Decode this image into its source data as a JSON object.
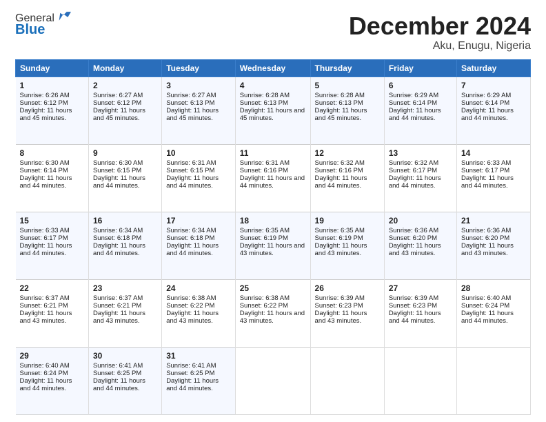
{
  "logo": {
    "general": "General",
    "blue": "Blue"
  },
  "header": {
    "month": "December 2024",
    "location": "Aku, Enugu, Nigeria"
  },
  "days_of_week": [
    "Sunday",
    "Monday",
    "Tuesday",
    "Wednesday",
    "Thursday",
    "Friday",
    "Saturday"
  ],
  "weeks": [
    [
      {
        "day": "1",
        "sunrise": "Sunrise: 6:26 AM",
        "sunset": "Sunset: 6:12 PM",
        "daylight": "Daylight: 11 hours and 45 minutes."
      },
      {
        "day": "2",
        "sunrise": "Sunrise: 6:27 AM",
        "sunset": "Sunset: 6:12 PM",
        "daylight": "Daylight: 11 hours and 45 minutes."
      },
      {
        "day": "3",
        "sunrise": "Sunrise: 6:27 AM",
        "sunset": "Sunset: 6:13 PM",
        "daylight": "Daylight: 11 hours and 45 minutes."
      },
      {
        "day": "4",
        "sunrise": "Sunrise: 6:28 AM",
        "sunset": "Sunset: 6:13 PM",
        "daylight": "Daylight: 11 hours and 45 minutes."
      },
      {
        "day": "5",
        "sunrise": "Sunrise: 6:28 AM",
        "sunset": "Sunset: 6:13 PM",
        "daylight": "Daylight: 11 hours and 45 minutes."
      },
      {
        "day": "6",
        "sunrise": "Sunrise: 6:29 AM",
        "sunset": "Sunset: 6:14 PM",
        "daylight": "Daylight: 11 hours and 44 minutes."
      },
      {
        "day": "7",
        "sunrise": "Sunrise: 6:29 AM",
        "sunset": "Sunset: 6:14 PM",
        "daylight": "Daylight: 11 hours and 44 minutes."
      }
    ],
    [
      {
        "day": "8",
        "sunrise": "Sunrise: 6:30 AM",
        "sunset": "Sunset: 6:14 PM",
        "daylight": "Daylight: 11 hours and 44 minutes."
      },
      {
        "day": "9",
        "sunrise": "Sunrise: 6:30 AM",
        "sunset": "Sunset: 6:15 PM",
        "daylight": "Daylight: 11 hours and 44 minutes."
      },
      {
        "day": "10",
        "sunrise": "Sunrise: 6:31 AM",
        "sunset": "Sunset: 6:15 PM",
        "daylight": "Daylight: 11 hours and 44 minutes."
      },
      {
        "day": "11",
        "sunrise": "Sunrise: 6:31 AM",
        "sunset": "Sunset: 6:16 PM",
        "daylight": "Daylight: 11 hours and 44 minutes."
      },
      {
        "day": "12",
        "sunrise": "Sunrise: 6:32 AM",
        "sunset": "Sunset: 6:16 PM",
        "daylight": "Daylight: 11 hours and 44 minutes."
      },
      {
        "day": "13",
        "sunrise": "Sunrise: 6:32 AM",
        "sunset": "Sunset: 6:17 PM",
        "daylight": "Daylight: 11 hours and 44 minutes."
      },
      {
        "day": "14",
        "sunrise": "Sunrise: 6:33 AM",
        "sunset": "Sunset: 6:17 PM",
        "daylight": "Daylight: 11 hours and 44 minutes."
      }
    ],
    [
      {
        "day": "15",
        "sunrise": "Sunrise: 6:33 AM",
        "sunset": "Sunset: 6:17 PM",
        "daylight": "Daylight: 11 hours and 44 minutes."
      },
      {
        "day": "16",
        "sunrise": "Sunrise: 6:34 AM",
        "sunset": "Sunset: 6:18 PM",
        "daylight": "Daylight: 11 hours and 44 minutes."
      },
      {
        "day": "17",
        "sunrise": "Sunrise: 6:34 AM",
        "sunset": "Sunset: 6:18 PM",
        "daylight": "Daylight: 11 hours and 44 minutes."
      },
      {
        "day": "18",
        "sunrise": "Sunrise: 6:35 AM",
        "sunset": "Sunset: 6:19 PM",
        "daylight": "Daylight: 11 hours and 43 minutes."
      },
      {
        "day": "19",
        "sunrise": "Sunrise: 6:35 AM",
        "sunset": "Sunset: 6:19 PM",
        "daylight": "Daylight: 11 hours and 43 minutes."
      },
      {
        "day": "20",
        "sunrise": "Sunrise: 6:36 AM",
        "sunset": "Sunset: 6:20 PM",
        "daylight": "Daylight: 11 hours and 43 minutes."
      },
      {
        "day": "21",
        "sunrise": "Sunrise: 6:36 AM",
        "sunset": "Sunset: 6:20 PM",
        "daylight": "Daylight: 11 hours and 43 minutes."
      }
    ],
    [
      {
        "day": "22",
        "sunrise": "Sunrise: 6:37 AM",
        "sunset": "Sunset: 6:21 PM",
        "daylight": "Daylight: 11 hours and 43 minutes."
      },
      {
        "day": "23",
        "sunrise": "Sunrise: 6:37 AM",
        "sunset": "Sunset: 6:21 PM",
        "daylight": "Daylight: 11 hours and 43 minutes."
      },
      {
        "day": "24",
        "sunrise": "Sunrise: 6:38 AM",
        "sunset": "Sunset: 6:22 PM",
        "daylight": "Daylight: 11 hours and 43 minutes."
      },
      {
        "day": "25",
        "sunrise": "Sunrise: 6:38 AM",
        "sunset": "Sunset: 6:22 PM",
        "daylight": "Daylight: 11 hours and 43 minutes."
      },
      {
        "day": "26",
        "sunrise": "Sunrise: 6:39 AM",
        "sunset": "Sunset: 6:23 PM",
        "daylight": "Daylight: 11 hours and 43 minutes."
      },
      {
        "day": "27",
        "sunrise": "Sunrise: 6:39 AM",
        "sunset": "Sunset: 6:23 PM",
        "daylight": "Daylight: 11 hours and 44 minutes."
      },
      {
        "day": "28",
        "sunrise": "Sunrise: 6:40 AM",
        "sunset": "Sunset: 6:24 PM",
        "daylight": "Daylight: 11 hours and 44 minutes."
      }
    ],
    [
      {
        "day": "29",
        "sunrise": "Sunrise: 6:40 AM",
        "sunset": "Sunset: 6:24 PM",
        "daylight": "Daylight: 11 hours and 44 minutes."
      },
      {
        "day": "30",
        "sunrise": "Sunrise: 6:41 AM",
        "sunset": "Sunset: 6:25 PM",
        "daylight": "Daylight: 11 hours and 44 minutes."
      },
      {
        "day": "31",
        "sunrise": "Sunrise: 6:41 AM",
        "sunset": "Sunset: 6:25 PM",
        "daylight": "Daylight: 11 hours and 44 minutes."
      },
      null,
      null,
      null,
      null
    ]
  ]
}
